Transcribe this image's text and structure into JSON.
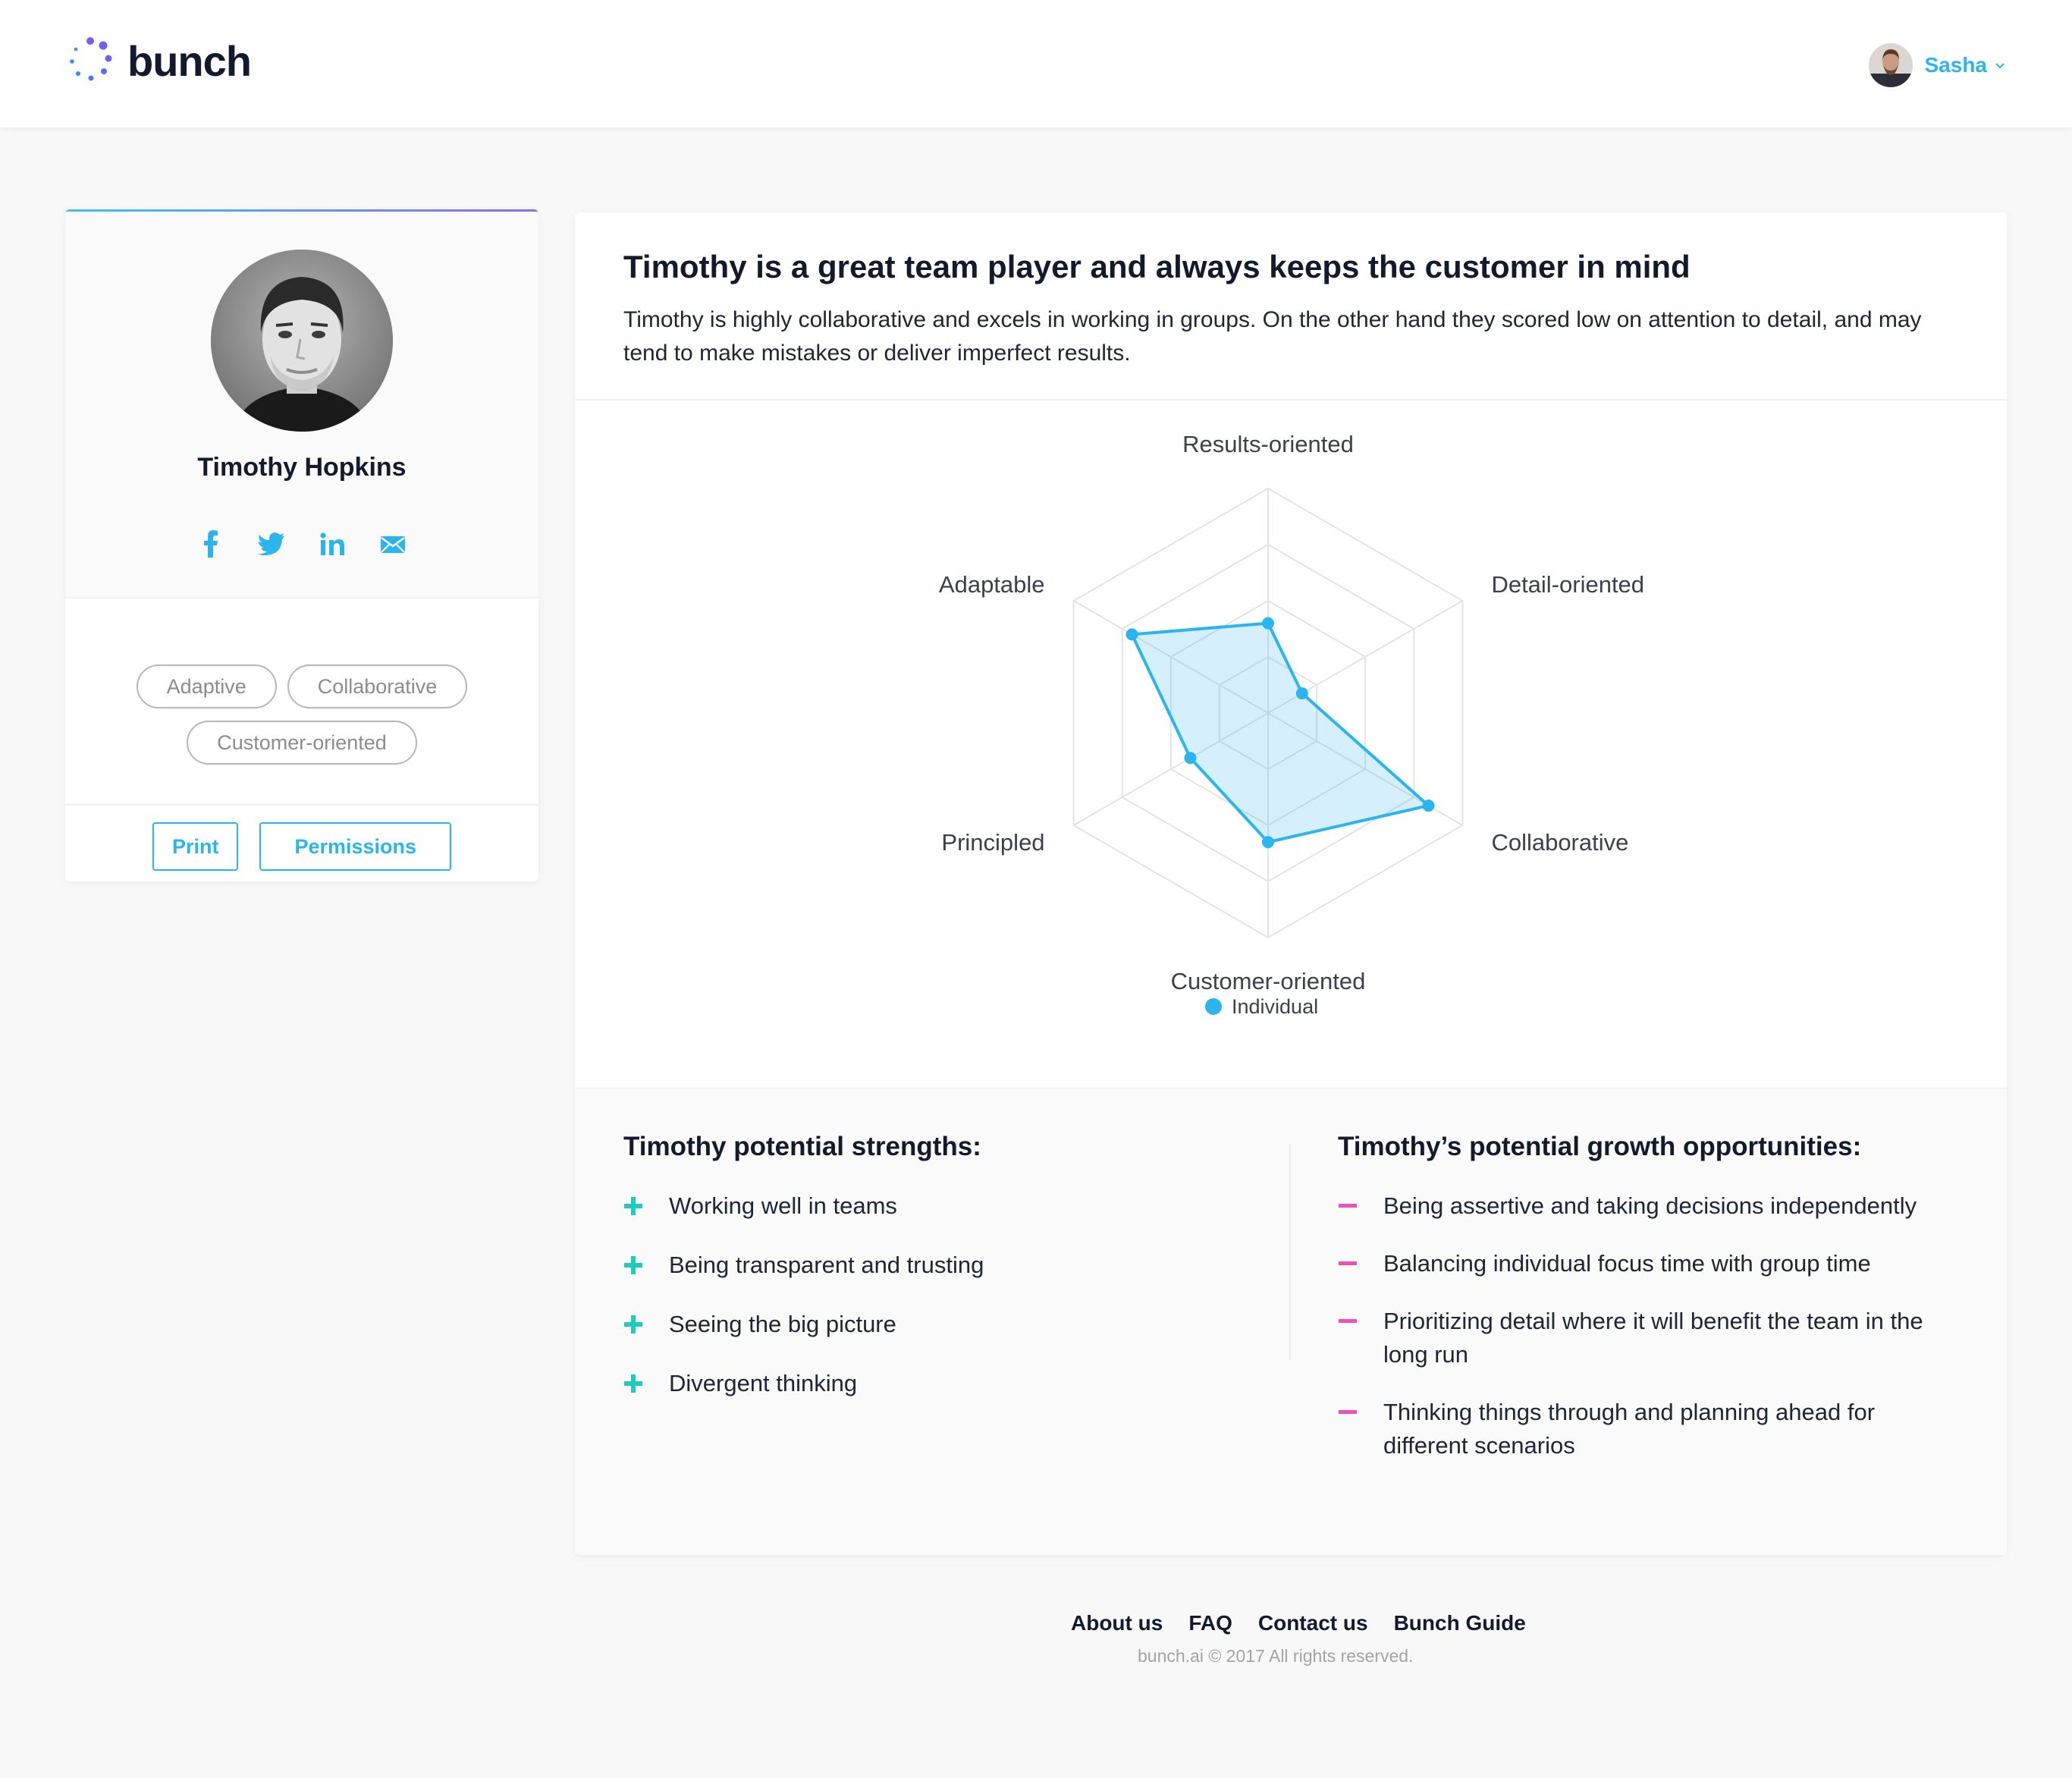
{
  "header": {
    "brand": "bunch",
    "user_name": "Sasha"
  },
  "profile": {
    "name": "Timothy Hopkins",
    "tags": [
      "Adaptive",
      "Collaborative",
      "Customer-oriented"
    ],
    "print_label": "Print",
    "permissions_label": "Permissions",
    "socials": [
      "facebook-icon",
      "twitter-icon",
      "linkedin-icon",
      "mail-icon"
    ]
  },
  "summary": {
    "title": "Timothy is a great team player and always keeps the customer in mind",
    "text": "Timothy is highly collaborative and excels in working in groups. On the other hand they scored low on attention to detail, and may tend to make mistakes or deliver imperfect results."
  },
  "chart_data": {
    "type": "radar",
    "axes": [
      "Results-oriented",
      "Detail-oriented",
      "Collaborative",
      "Customer-oriented",
      "Principled",
      "Adaptable"
    ],
    "rings": 4,
    "range": [
      0,
      4
    ],
    "series": [
      {
        "name": "Individual",
        "values": [
          1.6,
          0.7,
          3.3,
          2.3,
          1.6,
          2.8
        ],
        "color": "#2bb5ee"
      }
    ],
    "legend_position": "bottom"
  },
  "strengths": {
    "title": "Timothy potential strengths:",
    "items": [
      "Working well in teams",
      "Being transparent and trusting",
      "Seeing the big picture",
      "Divergent thinking"
    ]
  },
  "growth": {
    "title": "Timothy’s potential growth opportunities:",
    "items": [
      "Being assertive and taking decisions independently",
      "Balancing individual focus time with group time",
      "Prioritizing detail where it will benefit the team in the long run",
      "Thinking things through and planning ahead for different scenarios"
    ]
  },
  "footer": {
    "links": [
      "About us",
      "FAQ",
      "Contact us",
      "Bunch Guide"
    ],
    "copyright": "bunch.ai © 2017 All rights reserved."
  },
  "colors": {
    "accent": "#2bb5ee",
    "plus": "#1ccdbb",
    "minus": "#f04fb8",
    "text": "#141a2e"
  }
}
